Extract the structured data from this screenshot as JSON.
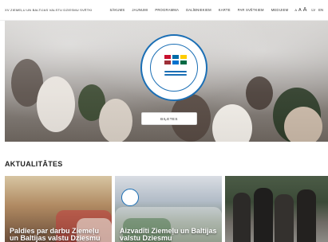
{
  "header": {
    "site_name": "XV ZIEMEĻU UN BALTIJAS VALSTU DZIESMU SVĒTKI",
    "nav": [
      "SĀKUMS",
      "JAUNUMI",
      "PROGRAMMA",
      "DALĪBNIEKIEM",
      "KARTE",
      "PAR SVĒTKIEM",
      "MEDIJIEM"
    ],
    "font_sizes": [
      "A",
      "A",
      "A"
    ],
    "languages": [
      "LV",
      "EN"
    ]
  },
  "hero": {
    "button_label": "BIĻETES",
    "logo_icon": "festival-emblem-icon"
  },
  "news": {
    "section_title": "AKTUALITĀTES",
    "cards": [
      {
        "title": "Paldies par darbu Ziemeļu un Baltijas valstu Dziesmu"
      },
      {
        "title": "Aizvadīti Ziemeļu un Baltijas valstu Dziesmu"
      },
      {
        "title": ""
      }
    ]
  },
  "colors": {
    "accent": "#1b6fb5",
    "background": "#ffffff"
  }
}
